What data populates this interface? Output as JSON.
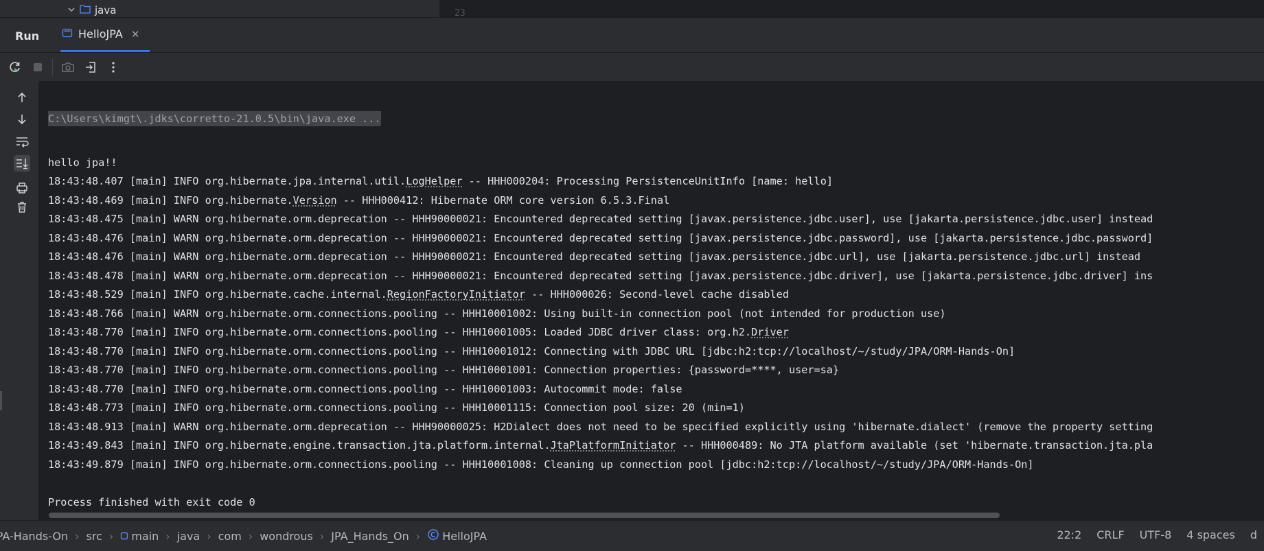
{
  "project_tree": {
    "visible_node": "java"
  },
  "editor": {
    "line_number": "23"
  },
  "run_panel": {
    "title": "Run",
    "tab": {
      "label": "HelloJPA"
    }
  },
  "console": {
    "command": "C:\\Users\\kimgt\\.jdks\\corretto-21.0.5\\bin\\java.exe ...",
    "lines": [
      "hello jpa!!",
      [
        "18:43:48.407 [main] INFO org.hibernate.jpa.internal.util.",
        "LogHelper",
        " -- HHH000204: Processing PersistenceUnitInfo [name: hello]"
      ],
      [
        "18:43:48.469 [main] INFO org.hibernate.",
        "Version",
        " -- HHH000412: Hibernate ORM core version 6.5.3.Final"
      ],
      "18:43:48.475 [main] WARN org.hibernate.orm.deprecation -- HHH90000021: Encountered deprecated setting [javax.persistence.jdbc.user], use [jakarta.persistence.jdbc.user] instead",
      "18:43:48.476 [main] WARN org.hibernate.orm.deprecation -- HHH90000021: Encountered deprecated setting [javax.persistence.jdbc.password], use [jakarta.persistence.jdbc.password]",
      "18:43:48.476 [main] WARN org.hibernate.orm.deprecation -- HHH90000021: Encountered deprecated setting [javax.persistence.jdbc.url], use [jakarta.persistence.jdbc.url] instead",
      "18:43:48.478 [main] WARN org.hibernate.orm.deprecation -- HHH90000021: Encountered deprecated setting [javax.persistence.jdbc.driver], use [jakarta.persistence.jdbc.driver] ins",
      [
        "18:43:48.529 [main] INFO org.hibernate.cache.internal.",
        "RegionFactoryInitiator",
        " -- HHH000026: Second-level cache disabled"
      ],
      "18:43:48.766 [main] WARN org.hibernate.orm.connections.pooling -- HHH10001002: Using built-in connection pool (not intended for production use)",
      [
        "18:43:48.770 [main] INFO org.hibernate.orm.connections.pooling -- HHH10001005: Loaded JDBC driver class: org.h2.",
        "Driver",
        ""
      ],
      "18:43:48.770 [main] INFO org.hibernate.orm.connections.pooling -- HHH10001012: Connecting with JDBC URL [jdbc:h2:tcp://localhost/~/study/JPA/ORM-Hands-On]",
      "18:43:48.770 [main] INFO org.hibernate.orm.connections.pooling -- HHH10001001: Connection properties: {password=****, user=sa}",
      "18:43:48.770 [main] INFO org.hibernate.orm.connections.pooling -- HHH10001003: Autocommit mode: false",
      "18:43:48.773 [main] INFO org.hibernate.orm.connections.pooling -- HHH10001115: Connection pool size: 20 (min=1)",
      "18:43:48.913 [main] WARN org.hibernate.orm.deprecation -- HHH90000025: H2Dialect does not need to be specified explicitly using 'hibernate.dialect' (remove the property setting",
      [
        "18:43:49.843 [main] INFO org.hibernate.engine.transaction.jta.platform.internal.",
        "JtaPlatformInitiator",
        " -- HHH000489: No JTA platform available (set 'hibernate.transaction.jta.pla"
      ],
      "18:43:49.879 [main] INFO org.hibernate.orm.connections.pooling -- HHH10001008: Cleaning up connection pool [jdbc:h2:tcp://localhost/~/study/JPA/ORM-Hands-On]",
      "",
      "Process finished with exit code 0"
    ]
  },
  "toolbar_icons": [
    "rerun-icon",
    "stop-icon",
    "camera-icon",
    "exit-icon",
    "more-icon"
  ],
  "side_icons": [
    "arrow-up-icon",
    "arrow-down-icon",
    "soft-wrap-icon",
    "scroll-to-end-icon",
    "print-icon",
    "trash-icon"
  ],
  "breadcrumbs": [
    "JPA-Hands-On",
    "src",
    "main",
    "java",
    "com",
    "wondrous",
    "JPA_Hands_On",
    "HelloJPA"
  ],
  "status": {
    "position": "22:2",
    "line_separator": "CRLF",
    "encoding": "UTF-8",
    "indent": "4 spaces"
  },
  "colors": {
    "accent": "#3574f0",
    "panel": "#2b2d30",
    "console_bg": "#1e1f22"
  }
}
